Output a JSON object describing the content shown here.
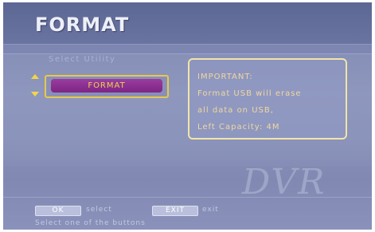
{
  "header": {
    "title": "FORMAT"
  },
  "utility": {
    "label": "Select Utility",
    "selected_option": "FORMAT"
  },
  "info": {
    "lines": [
      "IMPORTANT:",
      "Format USB will erase",
      "all data on USB,",
      "Left Capacity: 4M"
    ]
  },
  "watermark": {
    "text": "DVR"
  },
  "footer": {
    "ok_key": "OK",
    "ok_desc": "select",
    "exit_key": "EXIT",
    "exit_desc": "exit",
    "hint": "Select one of the buttons"
  },
  "colors": {
    "accent_yellow": "#f2d64a",
    "selected_fill": "#8a2e91",
    "background": "#7e88b3"
  }
}
